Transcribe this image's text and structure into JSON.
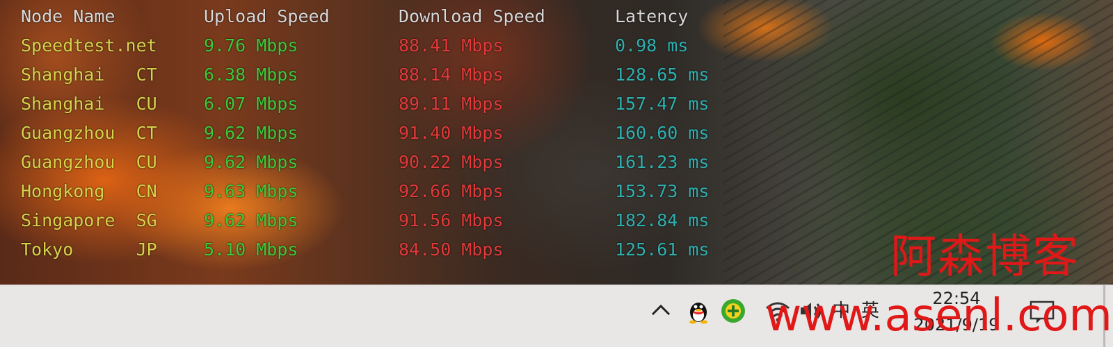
{
  "terminal": {
    "headers": {
      "node_name": "Node Name",
      "upload": "Upload Speed",
      "download": "Download Speed",
      "latency": "Latency"
    },
    "rows": [
      {
        "node": "Speedtest.net",
        "upload": "9.76 Mbps",
        "download": "88.41 Mbps",
        "latency": "0.98 ms"
      },
      {
        "node": "Shanghai   CT",
        "upload": "6.38 Mbps",
        "download": "88.14 Mbps",
        "latency": "128.65 ms"
      },
      {
        "node": "Shanghai   CU",
        "upload": "6.07 Mbps",
        "download": "89.11 Mbps",
        "latency": "157.47 ms"
      },
      {
        "node": "Guangzhou  CT",
        "upload": "9.62 Mbps",
        "download": "91.40 Mbps",
        "latency": "160.60 ms"
      },
      {
        "node": "Guangzhou  CU",
        "upload": "9.62 Mbps",
        "download": "90.22 Mbps",
        "latency": "161.23 ms"
      },
      {
        "node": "Hongkong   CN",
        "upload": "9.63 Mbps",
        "download": "92.66 Mbps",
        "latency": "153.73 ms"
      },
      {
        "node": "Singapore  SG",
        "upload": "9.62 Mbps",
        "download": "91.56 Mbps",
        "latency": "182.84 ms"
      },
      {
        "node": "Tokyo      JP",
        "upload": "5.10 Mbps",
        "download": "84.50 Mbps",
        "latency": "125.61 ms"
      }
    ],
    "colors": {
      "header": "#d8d8d8",
      "node": "#d6d34a",
      "upload": "#3ec83a",
      "download": "#e03a3a",
      "latency": "#2fb0b0"
    }
  },
  "taskbar": {
    "tray_icons": [
      "chevron-up-icon",
      "qq-penguin-icon",
      "360-security-icon",
      "wifi-icon",
      "volume-icon"
    ],
    "ime_label": "中",
    "ime_mode": "英",
    "clock_time": "22:54",
    "clock_date": "2021/9/19",
    "notification_icon": "notification-icon"
  },
  "watermark": {
    "title": "阿森博客",
    "url": "www.asenl.com",
    "color": "#e01818"
  }
}
